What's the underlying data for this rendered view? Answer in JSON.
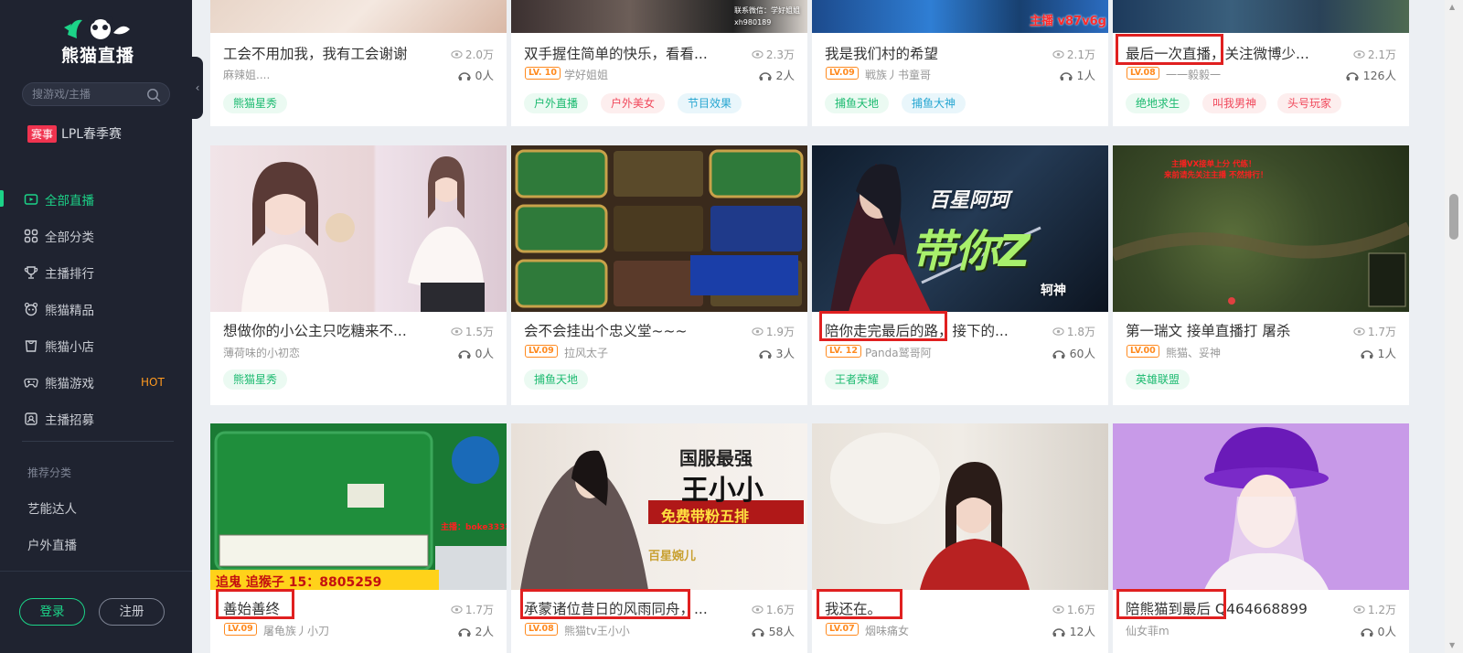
{
  "sidebar": {
    "logo_text": "熊猫直播",
    "search_placeholder": "搜游戏/主播",
    "event_badge": "赛事",
    "event_label": "LPL春季赛",
    "nav": [
      {
        "label": "全部直播",
        "icon": "live-tv-icon",
        "active": true
      },
      {
        "label": "全部分类",
        "icon": "grid-icon"
      },
      {
        "label": "主播排行",
        "icon": "trophy-icon"
      },
      {
        "label": "熊猫精品",
        "icon": "panda-icon"
      },
      {
        "label": "熊猫小店",
        "icon": "shop-bag-icon"
      },
      {
        "label": "熊猫游戏",
        "icon": "gamepad-icon",
        "badge": "HOT"
      },
      {
        "label": "主播招募",
        "icon": "recruit-icon"
      }
    ],
    "recommend_title": "推荐分类",
    "recommend_items": [
      "艺能达人",
      "户外直播"
    ],
    "login_label": "登录",
    "register_label": "注册"
  },
  "colors": {
    "accent": "#1cd388",
    "sidebar_bg": "#1f2330",
    "hot": "#ff9a1f",
    "highlight_box": "#e02020"
  },
  "rows": [
    {
      "cards": [
        {
          "title": "工会不用加我，我有工会谢谢",
          "views": "2.0万",
          "level": "",
          "author": "麻辣姐....",
          "online": "0人",
          "tags": [
            {
              "text": "熊猫星秀",
              "color": "green"
            }
          ]
        },
        {
          "title": "双手握住简单的快乐，看看...",
          "views": "2.3万",
          "level": "LV. 10",
          "author": "学好姐姐",
          "online": "2人",
          "tags": [
            {
              "text": "户外直播",
              "color": "green"
            },
            {
              "text": "户外美女",
              "color": "red"
            },
            {
              "text": "节目效果",
              "color": "blue"
            }
          ],
          "thumb_text": [
            "联系微信：学好姐姐",
            "xh980189"
          ]
        },
        {
          "title": "我是我们村的希望",
          "views": "2.1万",
          "level": "LV.09",
          "author": "戦族丿书童哥",
          "online": "1人",
          "tags": [
            {
              "text": "捕鱼天地",
              "color": "green"
            },
            {
              "text": "捕鱼大神",
              "color": "blue"
            }
          ],
          "thumb_text": [
            "主播 v87v6g"
          ]
        },
        {
          "title": "最后一次直播，关注微博少...",
          "views": "2.1万",
          "level": "LV.08",
          "author": "一一毅毅一",
          "online": "126人",
          "tags": [
            {
              "text": "绝地求生",
              "color": "green"
            },
            {
              "text": "叫我男神",
              "color": "red"
            },
            {
              "text": "头号玩家",
              "color": "red"
            }
          ]
        }
      ]
    },
    {
      "cards": [
        {
          "title": "想做你的小公主只吃糖来不...",
          "views": "1.5万",
          "level": "",
          "author": "薄荷味的小初恋",
          "online": "0人",
          "tags": [
            {
              "text": "熊猫星秀",
              "color": "green"
            }
          ]
        },
        {
          "title": "会不会挂出个忠义堂~~~",
          "views": "1.9万",
          "level": "LV.09",
          "author": "拉风太子",
          "online": "3人",
          "tags": [
            {
              "text": "捕鱼天地",
              "color": "green"
            }
          ]
        },
        {
          "title": "陪你走完最后的路，接下的...",
          "views": "1.8万",
          "level": "LV. 12",
          "author": "Panda鹫哥阿",
          "online": "60人",
          "tags": [
            {
              "text": "王者荣耀",
              "color": "green"
            }
          ],
          "thumb_text": [
            "百星阿珂",
            "带你Z",
            "轲神"
          ]
        },
        {
          "title": "第一瑞文 接单直播打 屠杀",
          "views": "1.7万",
          "level": "LV.00",
          "author": "熊猫、妥神",
          "online": "1人",
          "tags": [
            {
              "text": "英雄联盟",
              "color": "green"
            }
          ],
          "thumb_text": [
            "主播VX接单上分 代练！",
            "来前请先关注主播 不然排行！"
          ]
        }
      ]
    },
    {
      "cards": [
        {
          "title": "善始善终",
          "views": "1.7万",
          "level": "LV.09",
          "author": "屠龟族丿小刀",
          "online": "2人",
          "tags": [],
          "thumb_text": [
            "追鬼 追猴子 15：8805259",
            "主播：boke3333"
          ]
        },
        {
          "title": "承蒙诸位昔日的风雨同舟，...",
          "views": "1.6万",
          "level": "LV.08",
          "author": "熊猫tv王小小",
          "online": "58人",
          "tags": [],
          "thumb_text": [
            "国服最强",
            "王小小",
            "免费带粉五排",
            "百星婉儿"
          ]
        },
        {
          "title": "我还在。",
          "views": "1.6万",
          "level": "LV.07",
          "author": "烟味痛女",
          "online": "12人",
          "tags": []
        },
        {
          "title": "陪熊猫到最后  Q464668899",
          "views": "1.2万",
          "level": "",
          "author": "仙女菲m",
          "online": "0人",
          "tags": []
        }
      ]
    }
  ]
}
